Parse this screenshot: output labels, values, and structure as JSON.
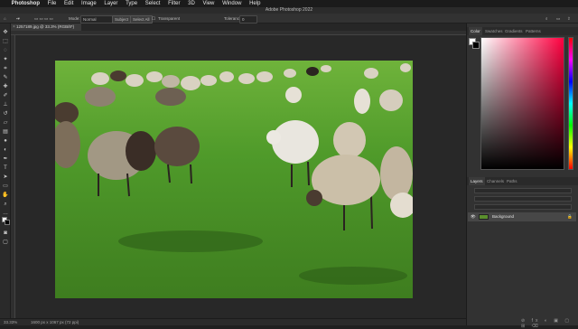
{
  "menubar": {
    "apple": "",
    "items": [
      "Photoshop",
      "File",
      "Edit",
      "Image",
      "Layer",
      "Type",
      "Select",
      "Filter",
      "3D",
      "View",
      "Window",
      "Help"
    ]
  },
  "window": {
    "title": "Adobe Photoshop 2022"
  },
  "options": {
    "mode_label": "Mode:",
    "mode_value": "Normal",
    "select_subject": "Subject",
    "select_all": "Select All",
    "transparent": "Transparent",
    "tolerance_label": "Tolerance:",
    "tolerance_value": "0"
  },
  "document": {
    "tab_label": "1257189.jpg @ 33.3% (RGB/8*)",
    "zoom": "33.33%"
  },
  "status": {
    "info": "1600 px x 1067 px (72 ppi)"
  },
  "panels": {
    "top_tabs": [
      "Color",
      "Swatches",
      "Gradients",
      "Patterns"
    ],
    "bottom_tabs": [
      "Layers",
      "Channels",
      "Paths"
    ]
  },
  "layers": [
    {
      "name": "Background",
      "visible": true,
      "locked": true
    }
  ],
  "colors": {
    "accent_foreground": "#ffffff",
    "accent_background": "#000000"
  },
  "icons": [
    "move-icon",
    "marquee-icon",
    "lasso-icon",
    "magic-wand-icon",
    "crop-icon",
    "eyedropper-icon",
    "healing-icon",
    "brush-icon",
    "stamp-icon",
    "history-brush-icon",
    "eraser-icon",
    "gradient-icon",
    "blur-icon",
    "dodge-icon",
    "pen-icon",
    "type-icon",
    "path-select-icon",
    "rectangle-icon",
    "hand-icon",
    "zoom-icon"
  ]
}
